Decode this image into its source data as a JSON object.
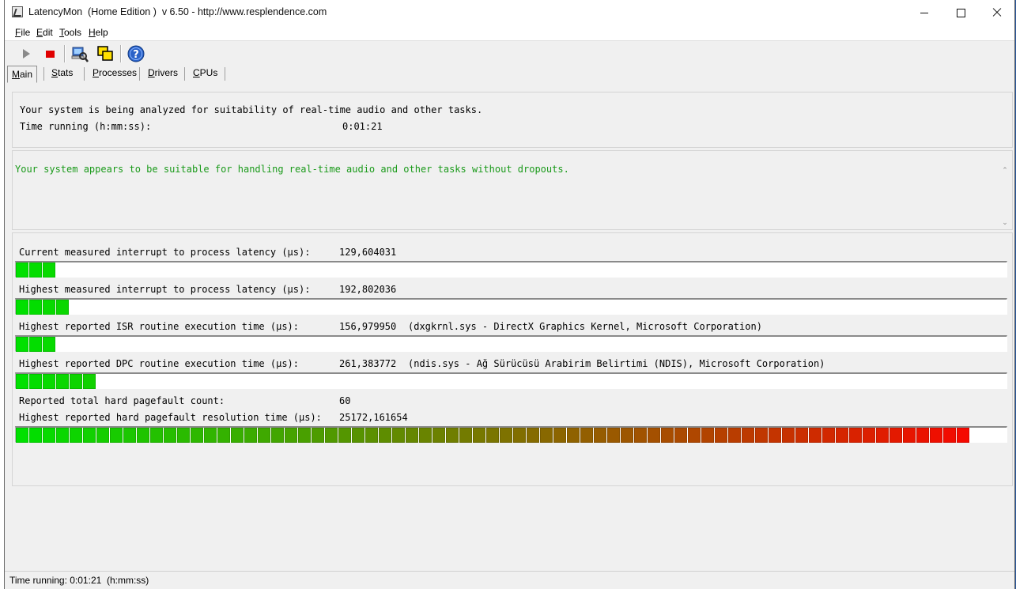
{
  "window": {
    "title": "LatencyMon  (Home Edition )  v 6.50 - http://www.resplendence.com"
  },
  "menu": [
    {
      "underline": "F",
      "rest": "ile"
    },
    {
      "underline": "E",
      "rest": "dit"
    },
    {
      "underline": "T",
      "rest": "ools"
    },
    {
      "underline": "H",
      "rest": "elp"
    }
  ],
  "toolbar": {
    "icons": [
      "play-icon",
      "stop-icon",
      "analyze-icon",
      "windows-icon",
      "help-icon"
    ]
  },
  "tabs": [
    {
      "underline": "M",
      "rest": "ain",
      "active": true
    },
    {
      "underline": "S",
      "rest": "tats",
      "active": false
    },
    {
      "underline": "P",
      "rest": "rocesses",
      "active": false
    },
    {
      "underline": "D",
      "rest": "rivers",
      "active": false
    },
    {
      "underline": "C",
      "rest": "PUs",
      "active": false
    }
  ],
  "summary": {
    "line1": "Your system is being analyzed for suitability of real-time audio and other tasks.",
    "time_label": "Time running (h:mm:ss):",
    "time_value": "0:01:21"
  },
  "verdict": "Your system appears to be suitable for handling real-time audio and other tasks without dropouts.",
  "metrics": [
    {
      "label": "Current measured interrupt to process latency (µs):",
      "value": "129,604031",
      "detail": "",
      "bar_segments": 3
    },
    {
      "label": "Highest measured interrupt to process latency (µs):",
      "value": "192,802036",
      "detail": "",
      "bar_segments": 4
    },
    {
      "label": "Highest reported ISR routine execution time (µs):",
      "value": "156,979950",
      "detail": "(dxgkrnl.sys - DirectX Graphics Kernel, Microsoft Corporation)",
      "bar_segments": 3
    },
    {
      "label": "Highest reported DPC routine execution time (µs):",
      "value": "261,383772",
      "detail": "(ndis.sys - Ağ Sürücüsü Arabirim Belirtimi (NDIS), Microsoft Corporation)",
      "bar_segments": 6
    }
  ],
  "pagefault": {
    "count_label": "Reported total hard pagefault count:",
    "count_value": "60",
    "time_label": "Highest reported hard pagefault resolution time (µs):",
    "time_value": "25172,161654",
    "bar_segments": 71,
    "bar_total_segments": 74
  },
  "colors": {
    "bar_start": "#00e000",
    "bar_end": "#ff0000",
    "verdict_text": "#1a9a1a"
  },
  "statusbar": {
    "text": "Time running: 0:01:21  (h:mm:ss)"
  }
}
